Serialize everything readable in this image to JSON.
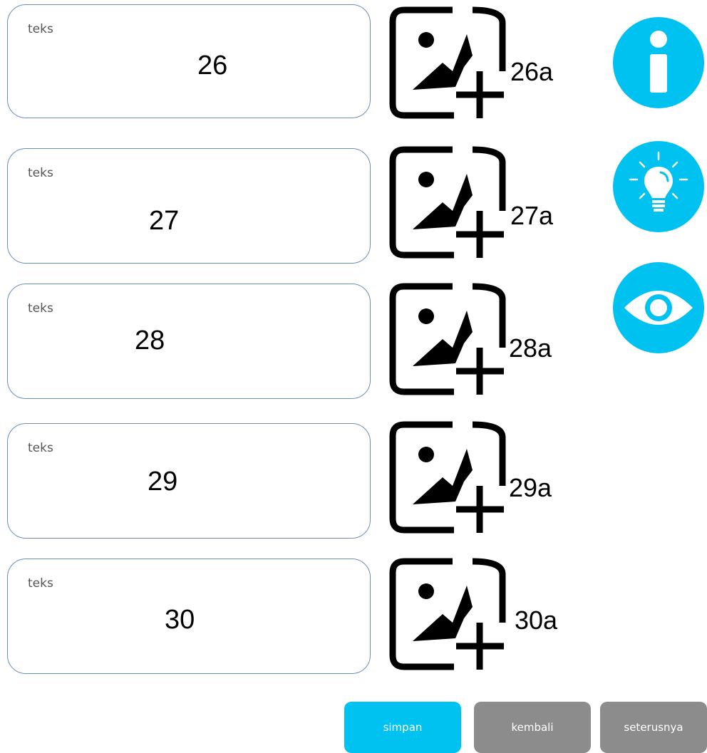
{
  "rows": [
    {
      "label": "teks",
      "value": "26",
      "image_label": "26a"
    },
    {
      "label": "teks",
      "value": "27",
      "image_label": "27a"
    },
    {
      "label": "teks",
      "value": "28",
      "image_label": "28a"
    },
    {
      "label": "teks",
      "value": "29",
      "image_label": "29a"
    },
    {
      "label": "teks",
      "value": "30",
      "image_label": "30a"
    }
  ],
  "side_buttons": [
    {
      "icon": "info-icon"
    },
    {
      "icon": "lightbulb-icon"
    },
    {
      "icon": "eye-icon"
    }
  ],
  "footer": {
    "save_label": "simpan",
    "back_label": "kembali",
    "next_label": "seterusnya"
  },
  "colors": {
    "accent": "#00c2f0",
    "secondary_button": "#8c8c8c",
    "card_border": "#6c8ebf"
  }
}
